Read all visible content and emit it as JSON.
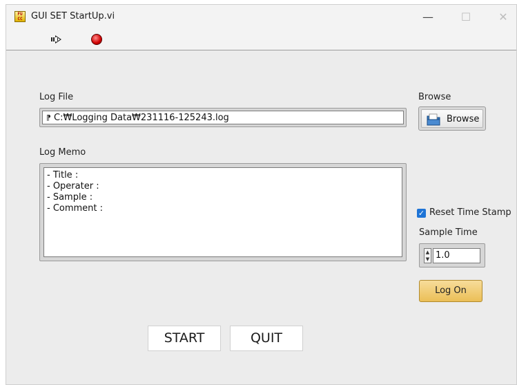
{
  "window": {
    "title": "GUI SET StartUp.vi",
    "controls": {
      "minimize": "—",
      "maximize": "☐",
      "close": "✕"
    }
  },
  "toolbar": {
    "run_icon": "run-arrow-icon",
    "stop_icon": "abort-stop-icon"
  },
  "log_file": {
    "label": "Log File",
    "path_glyph": "⁋",
    "value": "C:₩Logging Data₩231116-125243.log"
  },
  "browse": {
    "caption": "Browse",
    "button_label": "Browse",
    "icon": "folder-icon"
  },
  "log_memo": {
    "label": "Log Memo",
    "lines": [
      "- Title :",
      "- Operater :",
      "- Sample :",
      "- Comment :"
    ]
  },
  "reset_time_stamp": {
    "label": "Reset Time Stamp",
    "checked": true
  },
  "sample_time": {
    "label": "Sample Time",
    "value": "1.0"
  },
  "log_on_button": {
    "label": "Log On"
  },
  "actions": {
    "start_label": "START",
    "quit_label": "QUIT"
  },
  "colors": {
    "panel": "#ececec",
    "log_on": "#ebbf57",
    "checkbox": "#1e74d6",
    "stop": "#d10000"
  }
}
